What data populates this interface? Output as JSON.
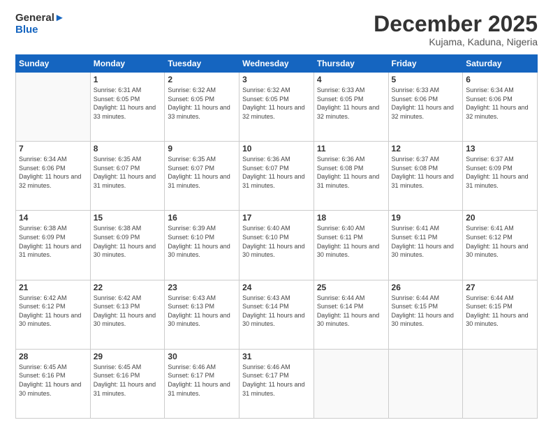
{
  "logo": {
    "general": "General",
    "blue": "Blue"
  },
  "header": {
    "month_year": "December 2025",
    "location": "Kujama, Kaduna, Nigeria"
  },
  "weekdays": [
    "Sunday",
    "Monday",
    "Tuesday",
    "Wednesday",
    "Thursday",
    "Friday",
    "Saturday"
  ],
  "weeks": [
    [
      {
        "day": "",
        "sunrise": "",
        "sunset": "",
        "daylight": ""
      },
      {
        "day": "1",
        "sunrise": "Sunrise: 6:31 AM",
        "sunset": "Sunset: 6:05 PM",
        "daylight": "Daylight: 11 hours and 33 minutes."
      },
      {
        "day": "2",
        "sunrise": "Sunrise: 6:32 AM",
        "sunset": "Sunset: 6:05 PM",
        "daylight": "Daylight: 11 hours and 33 minutes."
      },
      {
        "day": "3",
        "sunrise": "Sunrise: 6:32 AM",
        "sunset": "Sunset: 6:05 PM",
        "daylight": "Daylight: 11 hours and 32 minutes."
      },
      {
        "day": "4",
        "sunrise": "Sunrise: 6:33 AM",
        "sunset": "Sunset: 6:05 PM",
        "daylight": "Daylight: 11 hours and 32 minutes."
      },
      {
        "day": "5",
        "sunrise": "Sunrise: 6:33 AM",
        "sunset": "Sunset: 6:06 PM",
        "daylight": "Daylight: 11 hours and 32 minutes."
      },
      {
        "day": "6",
        "sunrise": "Sunrise: 6:34 AM",
        "sunset": "Sunset: 6:06 PM",
        "daylight": "Daylight: 11 hours and 32 minutes."
      }
    ],
    [
      {
        "day": "7",
        "sunrise": "Sunrise: 6:34 AM",
        "sunset": "Sunset: 6:06 PM",
        "daylight": "Daylight: 11 hours and 32 minutes."
      },
      {
        "day": "8",
        "sunrise": "Sunrise: 6:35 AM",
        "sunset": "Sunset: 6:07 PM",
        "daylight": "Daylight: 11 hours and 31 minutes."
      },
      {
        "day": "9",
        "sunrise": "Sunrise: 6:35 AM",
        "sunset": "Sunset: 6:07 PM",
        "daylight": "Daylight: 11 hours and 31 minutes."
      },
      {
        "day": "10",
        "sunrise": "Sunrise: 6:36 AM",
        "sunset": "Sunset: 6:07 PM",
        "daylight": "Daylight: 11 hours and 31 minutes."
      },
      {
        "day": "11",
        "sunrise": "Sunrise: 6:36 AM",
        "sunset": "Sunset: 6:08 PM",
        "daylight": "Daylight: 11 hours and 31 minutes."
      },
      {
        "day": "12",
        "sunrise": "Sunrise: 6:37 AM",
        "sunset": "Sunset: 6:08 PM",
        "daylight": "Daylight: 11 hours and 31 minutes."
      },
      {
        "day": "13",
        "sunrise": "Sunrise: 6:37 AM",
        "sunset": "Sunset: 6:09 PM",
        "daylight": "Daylight: 11 hours and 31 minutes."
      }
    ],
    [
      {
        "day": "14",
        "sunrise": "Sunrise: 6:38 AM",
        "sunset": "Sunset: 6:09 PM",
        "daylight": "Daylight: 11 hours and 31 minutes."
      },
      {
        "day": "15",
        "sunrise": "Sunrise: 6:38 AM",
        "sunset": "Sunset: 6:09 PM",
        "daylight": "Daylight: 11 hours and 30 minutes."
      },
      {
        "day": "16",
        "sunrise": "Sunrise: 6:39 AM",
        "sunset": "Sunset: 6:10 PM",
        "daylight": "Daylight: 11 hours and 30 minutes."
      },
      {
        "day": "17",
        "sunrise": "Sunrise: 6:40 AM",
        "sunset": "Sunset: 6:10 PM",
        "daylight": "Daylight: 11 hours and 30 minutes."
      },
      {
        "day": "18",
        "sunrise": "Sunrise: 6:40 AM",
        "sunset": "Sunset: 6:11 PM",
        "daylight": "Daylight: 11 hours and 30 minutes."
      },
      {
        "day": "19",
        "sunrise": "Sunrise: 6:41 AM",
        "sunset": "Sunset: 6:11 PM",
        "daylight": "Daylight: 11 hours and 30 minutes."
      },
      {
        "day": "20",
        "sunrise": "Sunrise: 6:41 AM",
        "sunset": "Sunset: 6:12 PM",
        "daylight": "Daylight: 11 hours and 30 minutes."
      }
    ],
    [
      {
        "day": "21",
        "sunrise": "Sunrise: 6:42 AM",
        "sunset": "Sunset: 6:12 PM",
        "daylight": "Daylight: 11 hours and 30 minutes."
      },
      {
        "day": "22",
        "sunrise": "Sunrise: 6:42 AM",
        "sunset": "Sunset: 6:13 PM",
        "daylight": "Daylight: 11 hours and 30 minutes."
      },
      {
        "day": "23",
        "sunrise": "Sunrise: 6:43 AM",
        "sunset": "Sunset: 6:13 PM",
        "daylight": "Daylight: 11 hours and 30 minutes."
      },
      {
        "day": "24",
        "sunrise": "Sunrise: 6:43 AM",
        "sunset": "Sunset: 6:14 PM",
        "daylight": "Daylight: 11 hours and 30 minutes."
      },
      {
        "day": "25",
        "sunrise": "Sunrise: 6:44 AM",
        "sunset": "Sunset: 6:14 PM",
        "daylight": "Daylight: 11 hours and 30 minutes."
      },
      {
        "day": "26",
        "sunrise": "Sunrise: 6:44 AM",
        "sunset": "Sunset: 6:15 PM",
        "daylight": "Daylight: 11 hours and 30 minutes."
      },
      {
        "day": "27",
        "sunrise": "Sunrise: 6:44 AM",
        "sunset": "Sunset: 6:15 PM",
        "daylight": "Daylight: 11 hours and 30 minutes."
      }
    ],
    [
      {
        "day": "28",
        "sunrise": "Sunrise: 6:45 AM",
        "sunset": "Sunset: 6:16 PM",
        "daylight": "Daylight: 11 hours and 30 minutes."
      },
      {
        "day": "29",
        "sunrise": "Sunrise: 6:45 AM",
        "sunset": "Sunset: 6:16 PM",
        "daylight": "Daylight: 11 hours and 31 minutes."
      },
      {
        "day": "30",
        "sunrise": "Sunrise: 6:46 AM",
        "sunset": "Sunset: 6:17 PM",
        "daylight": "Daylight: 11 hours and 31 minutes."
      },
      {
        "day": "31",
        "sunrise": "Sunrise: 6:46 AM",
        "sunset": "Sunset: 6:17 PM",
        "daylight": "Daylight: 11 hours and 31 minutes."
      },
      {
        "day": "",
        "sunrise": "",
        "sunset": "",
        "daylight": ""
      },
      {
        "day": "",
        "sunrise": "",
        "sunset": "",
        "daylight": ""
      },
      {
        "day": "",
        "sunrise": "",
        "sunset": "",
        "daylight": ""
      }
    ]
  ]
}
